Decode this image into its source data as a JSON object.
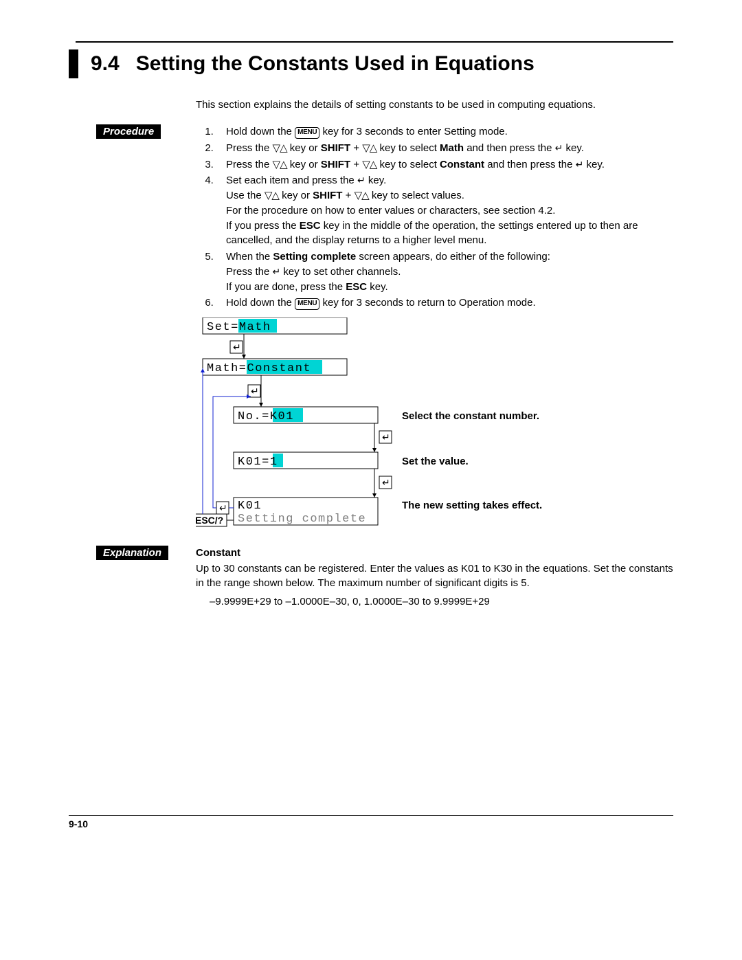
{
  "section": {
    "number": "9.4",
    "title": "Setting the Constants Used in Equations"
  },
  "intro": "This section explains the details of setting constants to be used in computing equations.",
  "badges": {
    "procedure": "Procedure",
    "explanation": "Explanation"
  },
  "keys": {
    "menu": "MENU",
    "shift": "SHIFT",
    "esc": "ESC",
    "esc_q": "ESC/?"
  },
  "glyph": {
    "triangles": "▽△",
    "enter": "↵"
  },
  "steps": {
    "s1a": "Hold down the ",
    "s1b": " key for 3 seconds to enter Setting mode.",
    "s2a": "Press the ",
    "s2b": " key or ",
    "s2shift": "SHIFT",
    "s2c": " + ",
    "s2d": " key to select ",
    "s2math": "Math",
    "s2e": " and then press the ",
    "s2f": " key.",
    "s3a": "Press the ",
    "s3b": " key or ",
    "s3c": " + ",
    "s3d": " key to select ",
    "s3const": "Constant",
    "s3e": " and then press the ",
    "s3f": " key.",
    "s4a": "Set each item and press the ",
    "s4b": " key.",
    "s4c": "Use the ",
    "s4d": " key or ",
    "s4e": " + ",
    "s4f": " key to select values.",
    "s4g": "For the procedure on how to enter values or characters, see section 4.2.",
    "s4h1": "If you press the ",
    "s4hesc": "ESC",
    "s4h2": " key in the middle of the operation, the settings entered up to then are cancelled, and the display returns to a higher level menu.",
    "s5a": "When the ",
    "s5b": "Setting complete",
    "s5c": " screen appears, do either of the following:",
    "s5d": "Press the ",
    "s5e": " key to set other channels.",
    "s5f": "If you are done, press the ",
    "s5g": " key.",
    "s6a": "Hold down the ",
    "s6b": " key for 3 seconds to return to Operation mode."
  },
  "diagram": {
    "box1_pre": "Set=",
    "box1_hl": "Math",
    "box2_pre": "Math=",
    "box2_hl": "Constant",
    "box3_pre": "No.=",
    "box3_hl": "K01",
    "box4_pre": "K01=",
    "box4_hl": "1",
    "box5_l1": "K01",
    "box5_l2": "Setting complete",
    "note3": "Select the constant number.",
    "note4": "Set the value.",
    "note5": "The new setting takes effect."
  },
  "explanation": {
    "heading": "Constant",
    "p1": "Up to 30 constants can be registered.  Enter the values as K01 to K30 in the equations.  Set the constants in the range shown below.  The maximum number of significant digits is 5.",
    "range": "–9.9999E+29 to –1.0000E–30, 0, 1.0000E–30 to 9.9999E+29"
  },
  "page_number": "9-10"
}
